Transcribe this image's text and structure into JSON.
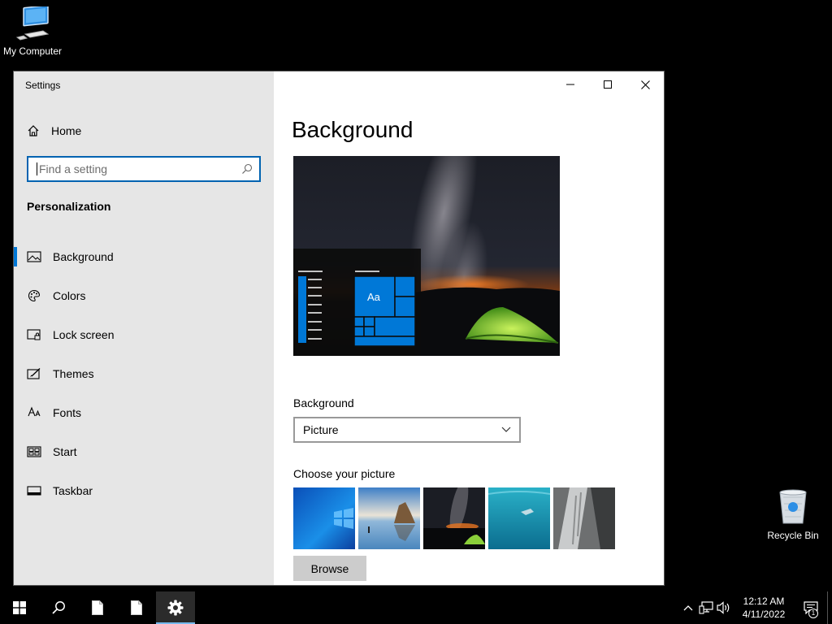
{
  "desktop": {
    "icons": [
      {
        "label": "My Computer",
        "icon": "computer-icon"
      },
      {
        "label": "Recycle Bin",
        "icon": "recycle-bin-icon"
      }
    ]
  },
  "window": {
    "title": "Settings",
    "controls": [
      "minimize-icon",
      "maximize-icon",
      "close-icon"
    ]
  },
  "sidebar": {
    "home_label": "Home",
    "search_placeholder": "Find a setting",
    "section": "Personalization",
    "items": [
      {
        "label": "Background",
        "icon": "picture-icon",
        "active": true
      },
      {
        "label": "Colors",
        "icon": "palette-icon",
        "active": false
      },
      {
        "label": "Lock screen",
        "icon": "lock-screen-icon",
        "active": false
      },
      {
        "label": "Themes",
        "icon": "themes-icon",
        "active": false
      },
      {
        "label": "Fonts",
        "icon": "fonts-icon",
        "active": false
      },
      {
        "label": "Start",
        "icon": "start-icon",
        "active": false
      },
      {
        "label": "Taskbar",
        "icon": "taskbar-icon",
        "active": false
      }
    ]
  },
  "main": {
    "title": "Background",
    "preview_tile_text": "Aa",
    "background_label": "Background",
    "background_value": "Picture",
    "choose_label": "Choose your picture",
    "browse_label": "Browse"
  },
  "taskbar": {
    "time": "12:12 AM",
    "date": "4/11/2022",
    "notification_count": "1"
  },
  "colors": {
    "accent": "#0078d7",
    "sidebar_bg": "#e6e6e6",
    "taskbar_bg": "#000000"
  }
}
